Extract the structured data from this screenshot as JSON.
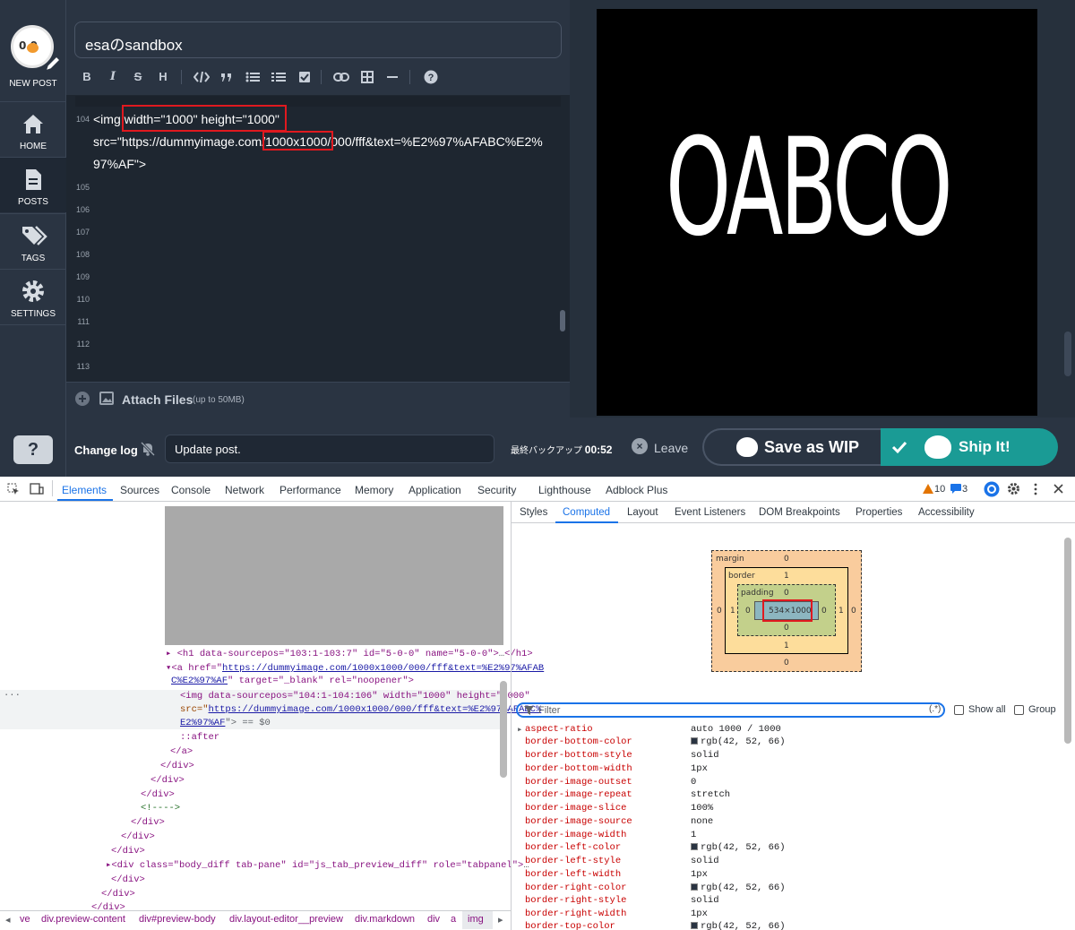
{
  "sidebar": {
    "logo_text": "0 0",
    "new_post": "NEW POST",
    "items": [
      {
        "label": "HOME",
        "icon": "home-icon"
      },
      {
        "label": "POSTS",
        "icon": "document-icon"
      },
      {
        "label": "TAGS",
        "icon": "tags-icon"
      },
      {
        "label": "SETTINGS",
        "icon": "gear-icon"
      }
    ],
    "help": "?"
  },
  "editor": {
    "title": "esaのsandbox",
    "toolbar": [
      "B",
      "I",
      "S",
      "H"
    ],
    "line_numbers": [
      "104",
      "105",
      "106",
      "107",
      "108",
      "109",
      "110",
      "111",
      "112",
      "113"
    ],
    "code_lines": [
      "<img width=\"1000\" height=\"1000\"",
      "src=\"https://dummyimage.com/1000x1000/000/fff&text=%E2%97%AFABC%E2%",
      "97%AF\">"
    ],
    "attach_label": "Attach Files",
    "attach_sub": "(up to 50MB)"
  },
  "preview": {
    "image_text": "OABCO"
  },
  "bottom": {
    "changelog": "Change log",
    "update_value": "Update post.",
    "backup_label": "最終バックアップ",
    "backup_time": "00:52",
    "leave": "Leave",
    "save_wip": "Save as WIP",
    "ship_it": "Ship It!"
  },
  "devtools": {
    "tabs": [
      "Elements",
      "Sources",
      "Console",
      "Network",
      "Performance",
      "Memory",
      "Application",
      "Security",
      "Lighthouse",
      "Adblock Plus"
    ],
    "warnings": "10",
    "messages": "3",
    "tree": {
      "h1": "<h1 data-sourcepos=\"103:1-103:7\" id=\"5-0-0\" name=\"5-0-0\">",
      "h1_close": "</h1>",
      "a_open": "<a href=\"",
      "a_href": "https://dummyimage.com/1000x1000/000/fff&text=%E2%97%AFAB",
      "a_href2": "C%E2%97%AF",
      "a_rest": "\" target=\"_blank\" rel=\"noopener\">",
      "img_line1": "<img data-sourcepos=\"104:1-104:106\" width=\"1000\" height=\"1000\"",
      "img_src_attr": "src=\"",
      "img_src": "https://dummyimage.com/1000x1000/000/fff&text=%E2%97%AFABC%",
      "img_src2": "E2%97%AF",
      "img_end": "\"> == $0",
      "after": "::after",
      "a_close": "</a>",
      "div_close": "</div>",
      "comment": "<!---->",
      "body_diff": "<div class=\"body_diff tab-pane\" id=\"js_tab_preview_diff\" role=\"tabpanel\">",
      "ellipsis": "…"
    },
    "breadcrumb": [
      "ve",
      "div.preview-content",
      "div#preview-body",
      "div.layout-editor__preview",
      "div.markdown",
      "div",
      "a",
      "img"
    ],
    "right_tabs": [
      "Styles",
      "Computed",
      "Layout",
      "Event Listeners",
      "DOM Breakpoints",
      "Properties",
      "Accessibility"
    ],
    "box_model": {
      "margin_label": "margin",
      "border_label": "border",
      "padding_label": "padding",
      "content": "534×1000",
      "margin_vals": [
        "0",
        "0",
        "0",
        "0"
      ],
      "border_vals": [
        "1",
        "1",
        "1",
        "1"
      ],
      "padding_vals": [
        "0",
        "0",
        "0",
        "0"
      ]
    },
    "filter_placeholder": "Filter",
    "filter_regex": "(.*)",
    "show_all": "Show all",
    "group": "Group",
    "computed": [
      {
        "prop": "aspect-ratio",
        "val": "auto 1000 / 1000"
      },
      {
        "prop": "border-bottom-color",
        "val": "rgb(42, 52, 66)",
        "swatch": true
      },
      {
        "prop": "border-bottom-style",
        "val": "solid"
      },
      {
        "prop": "border-bottom-width",
        "val": "1px"
      },
      {
        "prop": "border-image-outset",
        "val": "0"
      },
      {
        "prop": "border-image-repeat",
        "val": "stretch"
      },
      {
        "prop": "border-image-slice",
        "val": "100%"
      },
      {
        "prop": "border-image-source",
        "val": "none"
      },
      {
        "prop": "border-image-width",
        "val": "1"
      },
      {
        "prop": "border-left-color",
        "val": "rgb(42, 52, 66)",
        "swatch": true
      },
      {
        "prop": "border-left-style",
        "val": "solid"
      },
      {
        "prop": "border-left-width",
        "val": "1px"
      },
      {
        "prop": "border-right-color",
        "val": "rgb(42, 52, 66)",
        "swatch": true
      },
      {
        "prop": "border-right-style",
        "val": "solid"
      },
      {
        "prop": "border-right-width",
        "val": "1px"
      },
      {
        "prop": "border-top-color",
        "val": "rgb(42, 52, 66)",
        "swatch": true
      }
    ]
  },
  "colors": {
    "sidebar_bg": "#2a3442",
    "accent_ship": "#1a9b95",
    "highlight_red": "#e0191f",
    "devtools_blue": "#1a73e8"
  }
}
